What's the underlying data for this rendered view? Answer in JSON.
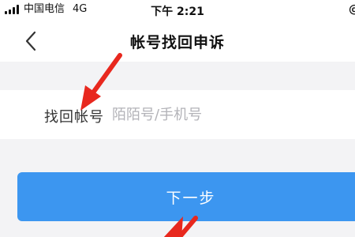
{
  "status_bar": {
    "carrier": "中国电信",
    "network": "4G",
    "time": "下午 2:21",
    "right_glyph": "@"
  },
  "nav": {
    "title": "帐号找回申诉",
    "back_icon": "chevron-left-icon"
  },
  "form": {
    "account_label": "找回帐号",
    "account_value": "",
    "account_placeholder": "陌陌号/手机号"
  },
  "next_button": {
    "label": "下一步"
  },
  "annotations": {
    "arrow_color": "#e8281e"
  },
  "colors": {
    "primary": "#3c96f0",
    "background": "#f3f3f5"
  }
}
